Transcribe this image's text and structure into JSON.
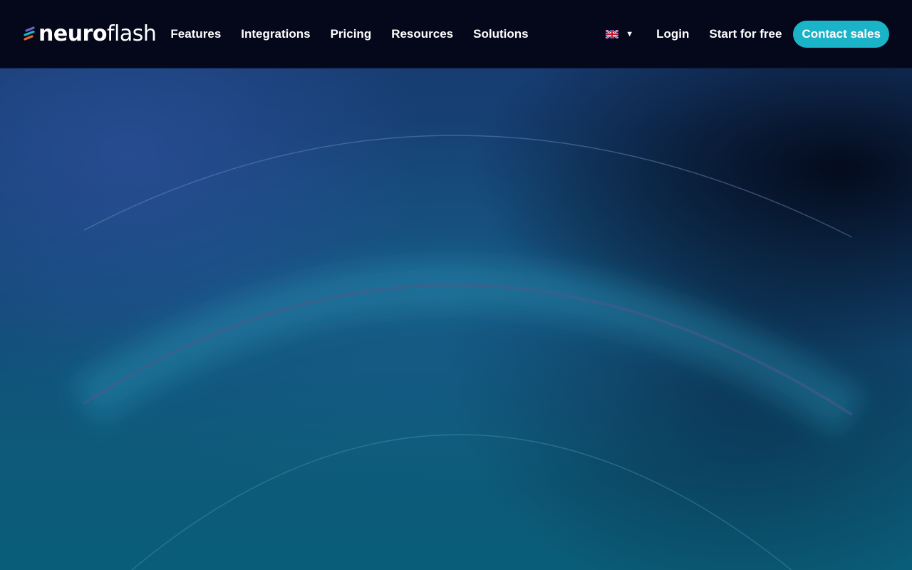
{
  "brand": {
    "name_bold": "neuro",
    "name_light": "flash",
    "logo_icon": "neuroflash-logo-icon"
  },
  "nav": {
    "links": [
      "Features",
      "Integrations",
      "Pricing",
      "Resources",
      "Solutions"
    ],
    "language_icon": "uk-flag-icon",
    "login_label": "Login",
    "start_label": "Start for free",
    "contact_label": "Contact sales"
  },
  "colors": {
    "nav_background": "#04081a",
    "accent": "#1bb3c7",
    "hero_top": "#173d72",
    "hero_bottom": "#0a5d78"
  }
}
